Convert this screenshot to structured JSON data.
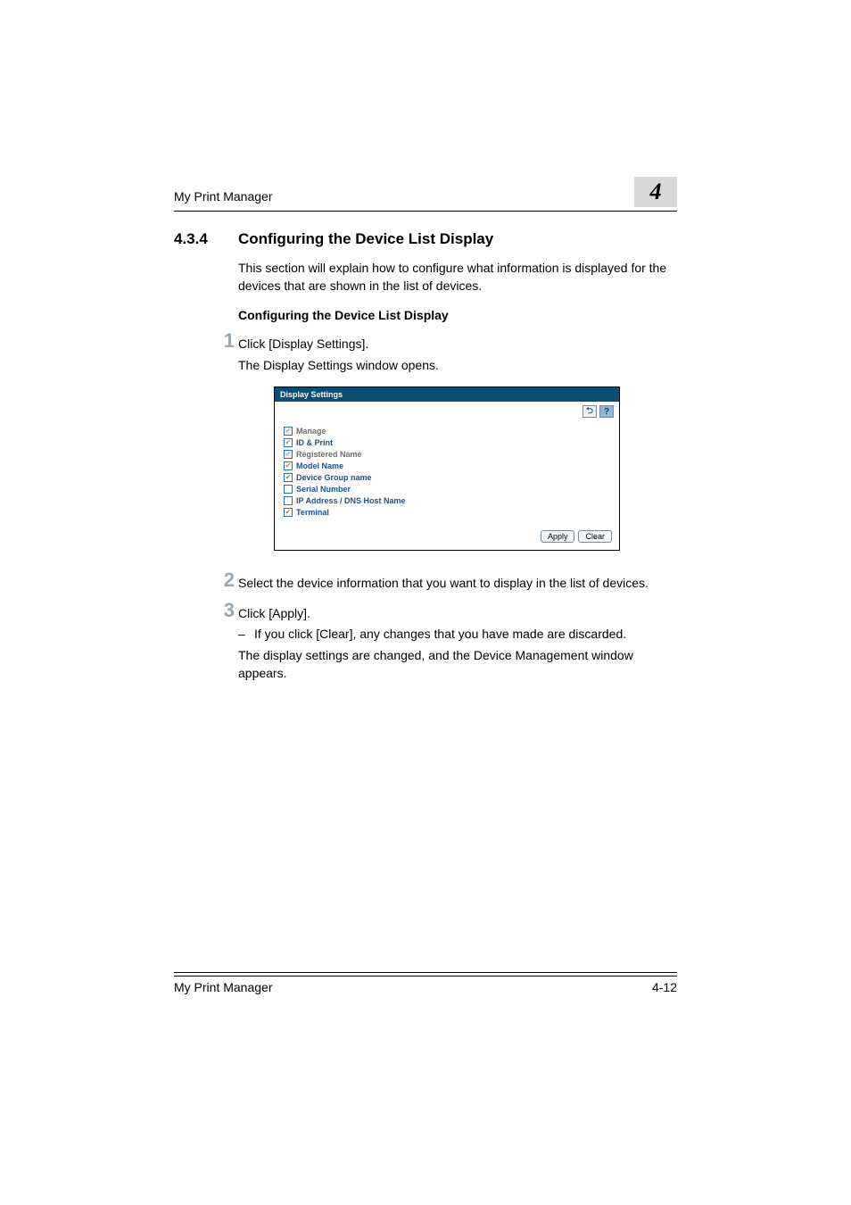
{
  "header": {
    "running_title": "My Print Manager",
    "chapter_number": "4"
  },
  "section": {
    "number": "4.3.4",
    "title": "Configuring the Device List Display",
    "intro": "This section will explain how to configure what information is displayed for the devices that are shown in the list of devices.",
    "sub_heading": "Configuring the Device List Display"
  },
  "steps": {
    "s1": {
      "num": "1",
      "text": "Click [Display Settings].",
      "after": "The Display Settings window opens."
    },
    "s2": {
      "num": "2",
      "text": "Select the device information that you want to display in the list of devices."
    },
    "s3": {
      "num": "3",
      "text": "Click [Apply].",
      "dash": "If you click [Clear], any changes that you have made are discarded.",
      "after": "The display settings are changed, and the Device Management window appears."
    }
  },
  "screenshot": {
    "title": "Display Settings",
    "back_glyph": "⮌",
    "help_glyph": "?",
    "options": [
      {
        "label": "Manage",
        "checked": true,
        "dim": true
      },
      {
        "label": "ID & Print",
        "checked": true,
        "dim": false
      },
      {
        "label": "Registered Name",
        "checked": true,
        "dim": true
      },
      {
        "label": "Model Name",
        "checked": true,
        "dim": false
      },
      {
        "label": "Device Group name",
        "checked": true,
        "dim": false
      },
      {
        "label": "Serial Number",
        "checked": false,
        "dim": false
      },
      {
        "label": "IP Address / DNS Host Name",
        "checked": false,
        "dim": false
      },
      {
        "label": "Terminal",
        "checked": true,
        "dim": false
      }
    ],
    "apply_label": "Apply",
    "clear_label": "Clear"
  },
  "footer": {
    "left": "My Print Manager",
    "right": "4-12"
  }
}
